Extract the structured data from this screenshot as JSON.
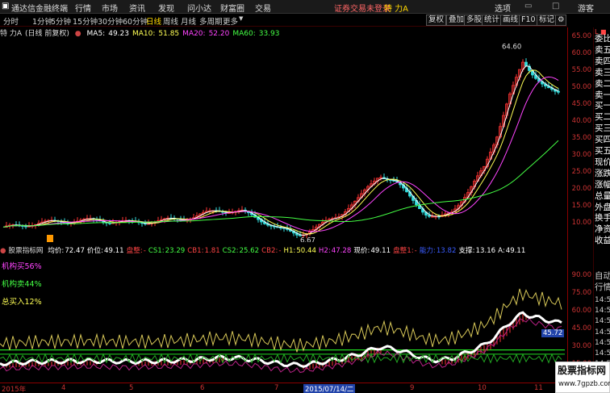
{
  "menubar": {
    "app_title": "通达信金融终端",
    "items": [
      "行情",
      "市场",
      "资讯",
      "发现",
      "问小达",
      "财富圈",
      "交易"
    ],
    "login_notice": "证券交易未登录",
    "stock_name": "特 力A",
    "right_items": [
      "选项",
      "游客"
    ]
  },
  "toolbar": {
    "periods": [
      "分时",
      "1分钟",
      "5分钟",
      "15分钟",
      "30分钟",
      "60分钟",
      "日线",
      "周线",
      "月线",
      "多周期",
      "更多"
    ],
    "active_period": "日线",
    "right_buttons": [
      "复权",
      "叠加",
      "多股",
      "统计",
      "画线",
      "F10",
      "标记"
    ]
  },
  "main_chart": {
    "stock_label": "特 力A",
    "mode": "(日线 前复权)",
    "ma": [
      {
        "label": "MA5:",
        "value": "49.23",
        "color": "#ffffff"
      },
      {
        "label": "MA10:",
        "value": "51.85",
        "color": "#ffff55"
      },
      {
        "label": "MA20:",
        "value": "52.20",
        "color": "#ff44ff"
      },
      {
        "label": "MA60:",
        "value": "33.93",
        "color": "#44ff44"
      }
    ],
    "annotations": {
      "high": "64.60",
      "low": "6.67"
    },
    "axis_ticks": [
      "65.00",
      "60.00",
      "55.00",
      "50.00",
      "45.00",
      "40.00",
      "35.00",
      "30.00",
      "25.00",
      "20.00",
      "15.00",
      "10.00"
    ]
  },
  "indicator": {
    "name": "股票指标网",
    "values": [
      {
        "label": "均价:",
        "value": "72.47",
        "color": "#ffffff"
      },
      {
        "label": "价位:",
        "value": "49.11",
        "color": "#ffffff"
      },
      {
        "label": "盘整:",
        "value": "-",
        "color": "#ff4444"
      },
      {
        "label": "CS1:",
        "value": "23.29",
        "color": "#44ff44"
      },
      {
        "label": "CB1:",
        "value": "1.81",
        "color": "#ff4444"
      },
      {
        "label": "CS2:",
        "value": "25.62",
        "color": "#44ff44"
      },
      {
        "label": "CB2:",
        "value": "-",
        "color": "#ff4444"
      },
      {
        "label": "H1:",
        "value": "50.44",
        "color": "#ffff55"
      },
      {
        "label": "H2:",
        "value": "47.28",
        "color": "#ff44ff"
      },
      {
        "label": "现价:",
        "value": "49.11",
        "color": "#ffffff"
      },
      {
        "label": "盘整1:",
        "value": "-",
        "color": "#ff4444"
      },
      {
        "label": "能力:",
        "value": "13.82",
        "color": "#3a5cff"
      },
      {
        "label": "支撑:",
        "value": "13.16",
        "color": "#ffffff"
      },
      {
        "label": "A:",
        "value": "49.11",
        "color": "#ffffff"
      }
    ],
    "side_labels": [
      {
        "text": "机构买56%",
        "color": "#ff44ff"
      },
      {
        "text": "机构卖44%",
        "color": "#44ff44"
      },
      {
        "text": "总买入12%",
        "color": "#ffff55"
      }
    ],
    "axis_ticks": [
      "90.00",
      "75.00",
      "60.00",
      "45.00",
      "30.00",
      "15.00"
    ],
    "marker_value": "45.72"
  },
  "right_panel": {
    "items": [
      {
        "text": "委比",
        "color": "#ffffff"
      },
      {
        "text": "卖五",
        "color": "#ffffff"
      },
      {
        "text": "卖四",
        "color": "#ffffff"
      },
      {
        "text": "卖三",
        "color": "#ffffff"
      },
      {
        "text": "卖二",
        "color": "#ffffff"
      },
      {
        "text": "卖一",
        "color": "#ffffff"
      },
      {
        "text": "买一",
        "color": "#ffffff"
      },
      {
        "text": "买二",
        "color": "#ffffff"
      },
      {
        "text": "买三",
        "color": "#ffffff"
      },
      {
        "text": "买四",
        "color": "#ffffff"
      },
      {
        "text": "买五",
        "color": "#ffffff"
      },
      {
        "text": "现价",
        "color": "#ffffff"
      },
      {
        "text": "涨跌",
        "color": "#ffffff"
      },
      {
        "text": "涨幅",
        "color": "#ffffff"
      },
      {
        "text": "总量",
        "color": "#ffffff"
      },
      {
        "text": "外盘",
        "color": "#ffffff"
      },
      {
        "text": "换手",
        "color": "#ffffff"
      },
      {
        "text": "净资",
        "color": "#ffffff"
      },
      {
        "text": "收益",
        "color": "#ffffff"
      }
    ],
    "ticker_header": "自动",
    "ticker_sub": "行情",
    "times": [
      "14:5",
      "14:5",
      "14:5",
      "14:5",
      "14:5",
      "14:5",
      "14:5",
      "14:5",
      "14:5",
      "14:5"
    ]
  },
  "bottom_axis": {
    "labels": [
      "2015年",
      "4",
      "5",
      "6",
      "7",
      "2015/07/14/二",
      "9",
      "10",
      "11"
    ]
  },
  "watermark": {
    "line1": "股票指标网",
    "line2": "www.7gpzb.com"
  },
  "colors": {
    "up": "#ff3333",
    "down": "#33dddd",
    "ma5": "#ffffff",
    "ma10": "#ffff55",
    "ma20": "#ff44ff",
    "ma60": "#44ff44",
    "axis": "#cc3333"
  }
}
